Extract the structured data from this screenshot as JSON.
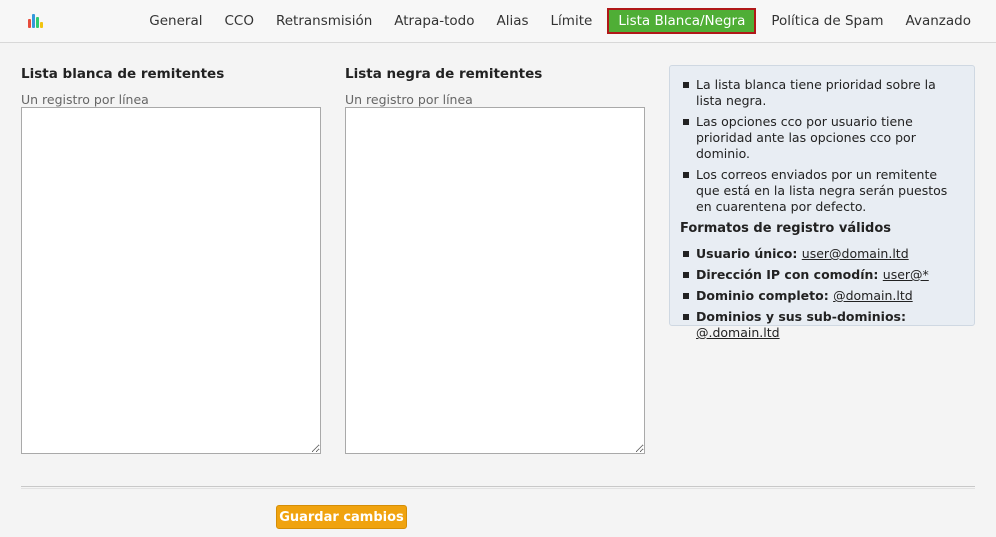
{
  "nav": {
    "tabs": [
      {
        "label": "General"
      },
      {
        "label": "CCO"
      },
      {
        "label": "Retransmisión"
      },
      {
        "label": "Atrapa-todo"
      },
      {
        "label": "Alias"
      },
      {
        "label": "Límite"
      },
      {
        "label": "Lista Blanca/Negra",
        "active": true
      },
      {
        "label": "Política de Spam"
      },
      {
        "label": "Avanzado"
      }
    ],
    "active_color": "#4fae36"
  },
  "whitelist": {
    "title": "Lista blanca de remitentes",
    "hint": "Un registro por línea",
    "value": ""
  },
  "blacklist": {
    "title": "Lista negra de remitentes",
    "hint": "Un registro por línea",
    "value": ""
  },
  "info": {
    "notes": [
      "La lista blanca tiene prioridad sobre la lista negra.",
      "Las opciones cco por usuario tiene prioridad ante las opciones cco por dominio.",
      "Los correos enviados por un remitente que está en la lista negra serán puestos en cuarentena por defecto."
    ],
    "formats_title": "Formatos de registro válidos",
    "formats": [
      {
        "label": "Usuario único:",
        "example": "user@domain.ltd"
      },
      {
        "label": "Dirección IP con comodín:",
        "example": "user@*"
      },
      {
        "label": "Dominio completo:",
        "example": "@domain.ltd"
      },
      {
        "label": "Dominios y sus sub-dominios:",
        "example": "@.domain.ltd"
      }
    ]
  },
  "actions": {
    "save_label": "Guardar cambios",
    "save_color": "#f0a30f"
  }
}
